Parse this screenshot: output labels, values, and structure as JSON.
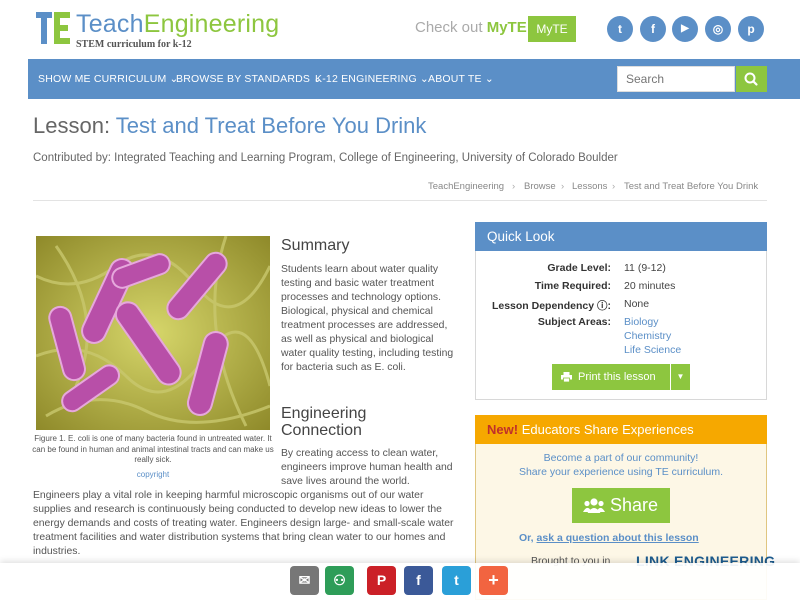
{
  "header": {
    "logo_teach": "Teach",
    "logo_engineering": "Engineering",
    "tagline": "STEM curriculum for k-12",
    "checkout_text": "Check out",
    "checkout_brand": "MyTE",
    "myte_button": "MyTE",
    "social": [
      {
        "icon": "twitter-icon",
        "glyph": "t"
      },
      {
        "icon": "facebook-icon",
        "glyph": "f"
      },
      {
        "icon": "youtube-icon",
        "glyph": "▶"
      },
      {
        "icon": "instagram-icon",
        "glyph": "◎"
      },
      {
        "icon": "pinterest-icon",
        "glyph": "p"
      }
    ]
  },
  "nav": {
    "items": [
      "SHOW ME CURRICULUM",
      "BROWSE BY STANDARDS",
      "K-12 ENGINEERING",
      "ABOUT TE"
    ],
    "search_placeholder": "Search"
  },
  "lesson": {
    "prefix": "Lesson:",
    "title": "Test and Treat Before You Drink",
    "contributed": "Contributed by: Integrated Teaching and Learning Program, College of Engineering, University of Colorado Boulder"
  },
  "breadcrumb": [
    "TeachEngineering",
    "Browse",
    "Lessons",
    "Test and Treat Before You Drink"
  ],
  "figure": {
    "caption": "Figure 1. E. coli is one of many bacteria found in untreated water. It can be found in human and animal intestinal tracts and can make us really sick.",
    "link": "copyright"
  },
  "summary": {
    "heading": "Summary",
    "text": "Students learn about water quality testing and basic water treatment processes and technology options. Biological, physical and chemical treatment processes are addressed, as well as physical and biological water quality testing, including testing for bacteria such as E. coli."
  },
  "engineering": {
    "heading_line1": "Engineering",
    "heading_line2": "Connection",
    "text_top": "By creating access to clean water, engineers improve human health and save lives around the world.",
    "text_full": "Engineers play a vital role in keeping harmful microscopic organisms out of our water supplies and research is continuously being conducted to develop new ideas to lower the energy demands and costs of treating water. Engineers design large- and small-scale water treatment facilities and water distribution systems that bring clean water to our homes and industries."
  },
  "quick_look": {
    "heading": "Quick Look",
    "grade_label": "Grade Level:",
    "grade_value": "11 (9-12)",
    "time_label": "Time Required:",
    "time_value": "20 minutes",
    "dependency_label": "Lesson Dependency",
    "dependency_value": "None",
    "subjects_label": "Subject Areas:",
    "subjects": [
      "Biology",
      "Chemistry",
      "Life Science"
    ],
    "print_button": "Print this lesson"
  },
  "educators": {
    "new": "New!",
    "heading": "Educators Share Experiences",
    "line1": "Become a part of our community!",
    "line2": "Share your experience using TE curriculum.",
    "share_button": "Share",
    "or": "Or,",
    "ask": "ask a question about this lesson",
    "brought": "Brought to you in",
    "brought_logo": "LINK ENGINEERING"
  },
  "share_bar": [
    {
      "icon": "email-icon",
      "glyph": "✉",
      "color": "#777777"
    },
    {
      "icon": "google-classroom-icon",
      "glyph": "⚇",
      "color": "#2e9d58"
    },
    {
      "icon": "pinterest-icon",
      "glyph": "P",
      "color": "#cb2027"
    },
    {
      "icon": "facebook-icon",
      "glyph": "f",
      "color": "#3b5998"
    },
    {
      "icon": "twitter-icon",
      "glyph": "t",
      "color": "#2a9fd8"
    },
    {
      "icon": "more-icon",
      "glyph": "+",
      "color": "#f26440"
    }
  ],
  "colors": {
    "brand_blue": "#5b8fc7",
    "brand_green": "#8dc63f",
    "educators_orange": "#f6a800"
  }
}
